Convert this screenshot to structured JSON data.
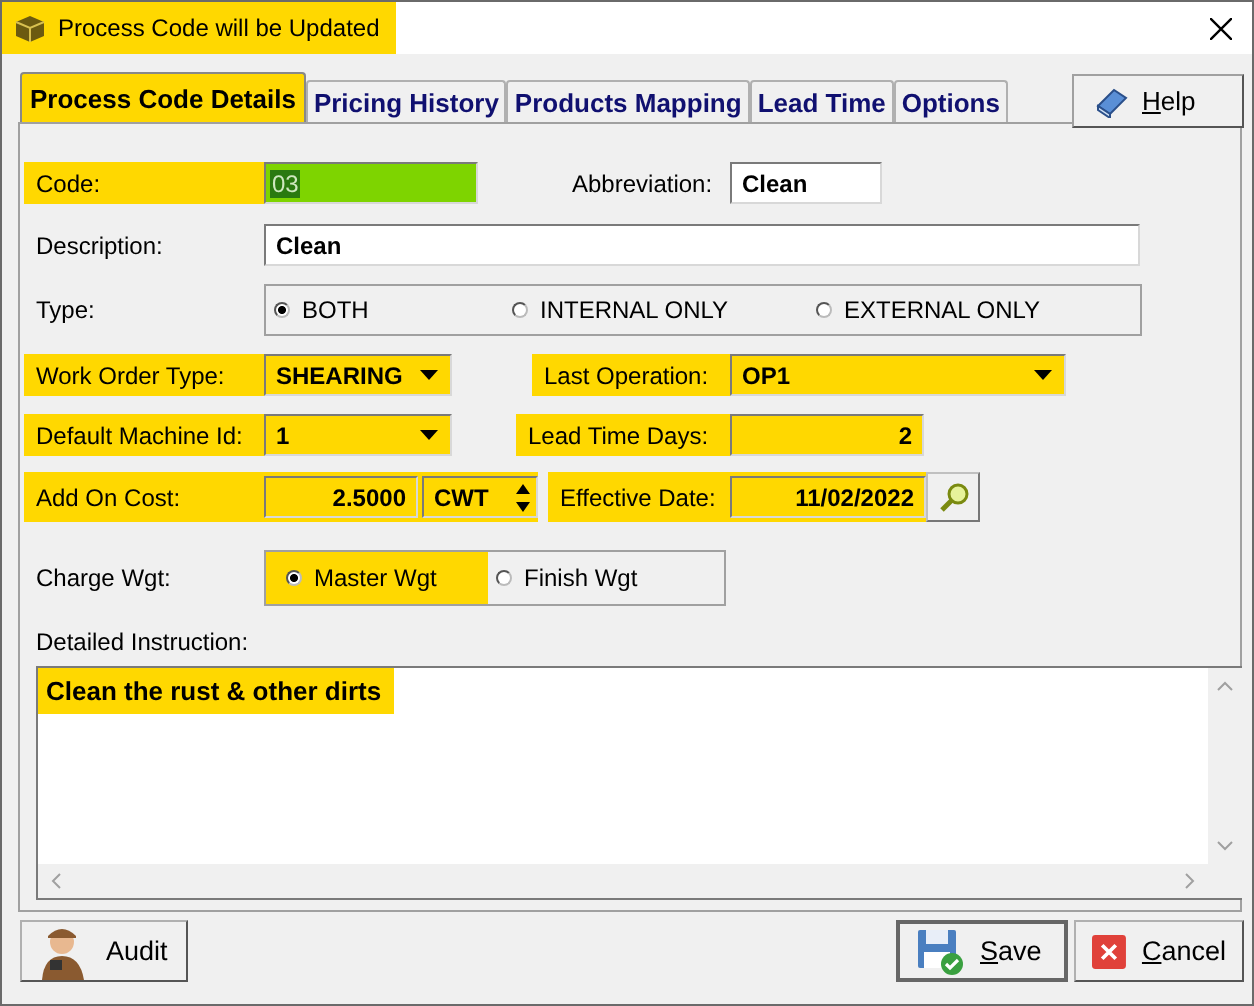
{
  "window": {
    "title": "Process Code will be Updated",
    "highlighted": true
  },
  "tabs": [
    {
      "label": "Process Code Details",
      "selected": true
    },
    {
      "label": "Pricing History",
      "selected": false
    },
    {
      "label": "Products Mapping",
      "selected": false
    },
    {
      "label": "Lead Time",
      "selected": false
    },
    {
      "label": "Options",
      "selected": false
    }
  ],
  "help_button": {
    "label": "Help"
  },
  "code": {
    "label": "Code:",
    "value": "03",
    "highlighted": true
  },
  "abbreviation": {
    "label": "Abbreviation:",
    "value": "Clean"
  },
  "description": {
    "label": "Description:",
    "value": "Clean"
  },
  "type": {
    "label": "Type:",
    "options": [
      {
        "label": "BOTH",
        "selected": true
      },
      {
        "label": "INTERNAL ONLY",
        "selected": false
      },
      {
        "label": "EXTERNAL ONLY",
        "selected": false
      }
    ]
  },
  "work_order_type": {
    "label": "Work Order Type:",
    "value": "SHEARING",
    "highlighted": true
  },
  "last_operation": {
    "label": "Last Operation:",
    "value": "OP1",
    "highlighted": true
  },
  "default_machine_id": {
    "label": "Default Machine Id:",
    "value": "1",
    "highlighted": true
  },
  "lead_time_days": {
    "label": "Lead Time Days:",
    "value": "2",
    "highlighted": true
  },
  "add_on_cost": {
    "label": "Add On Cost:",
    "value": "2.5000",
    "unit": "CWT",
    "highlighted": true
  },
  "effective_date": {
    "label": "Effective Date:",
    "value": "11/02/2022",
    "highlighted": true
  },
  "charge_wgt": {
    "label": "Charge Wgt:",
    "highlighted": true,
    "options": [
      {
        "label": "Master Wgt",
        "selected": true
      },
      {
        "label": "Finish Wgt",
        "selected": false
      }
    ]
  },
  "detailed_instruction": {
    "label": "Detailed Instruction:",
    "value": "Clean the rust & other dirts",
    "highlighted": true
  },
  "buttons": [
    {
      "label": "Audit",
      "kind": "audit"
    },
    {
      "label": "Save",
      "kind": "save"
    },
    {
      "label": "Cancel",
      "kind": "cancel"
    }
  ]
}
